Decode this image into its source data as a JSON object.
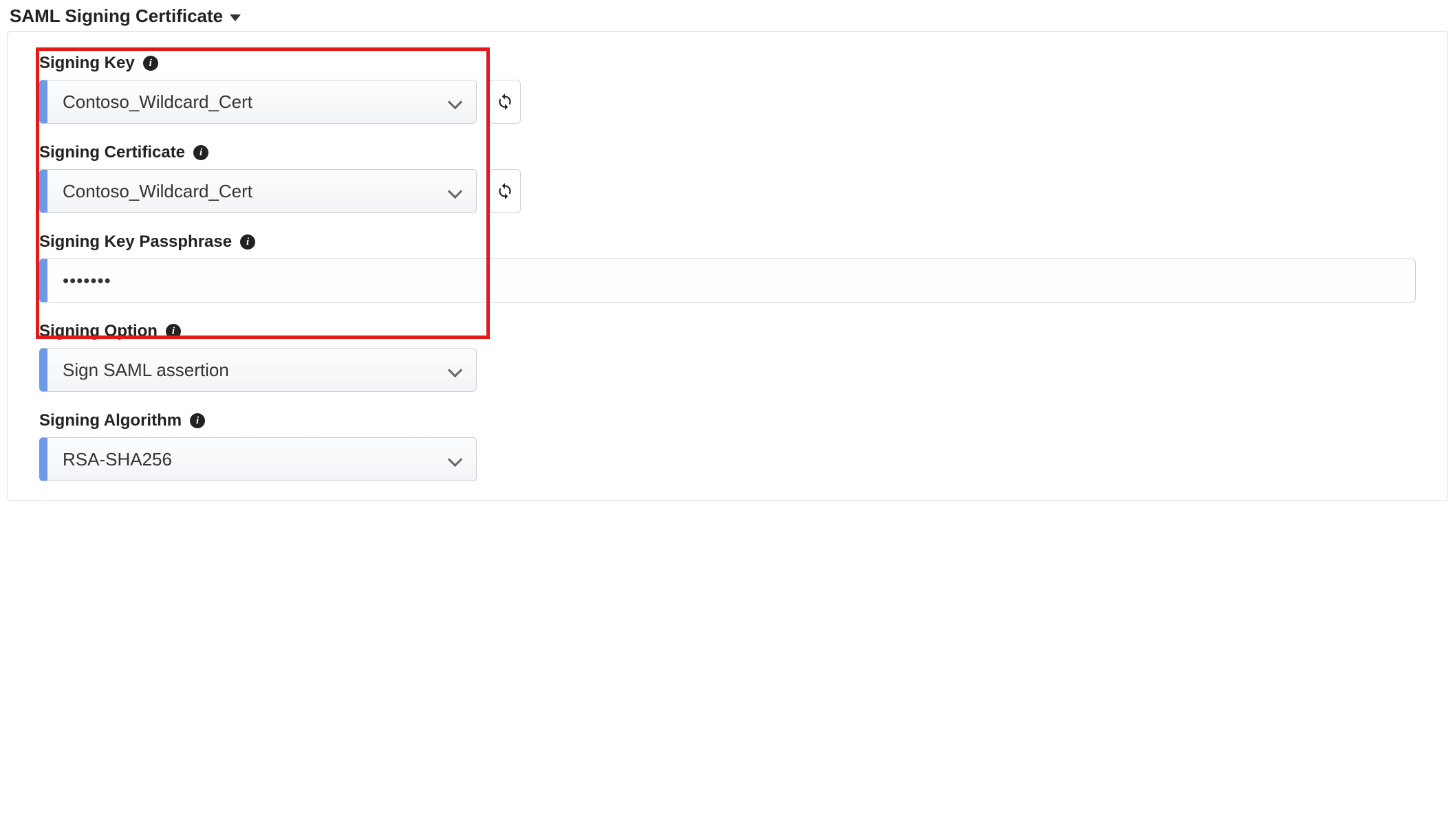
{
  "section_title": "SAML Signing Certificate",
  "fields": {
    "signing_key": {
      "label": "Signing Key",
      "value": "Contoso_Wildcard_Cert"
    },
    "signing_cert": {
      "label": "Signing Certificate",
      "value": "Contoso_Wildcard_Cert"
    },
    "signing_passphrase": {
      "label": "Signing Key Passphrase",
      "value": "•••••••"
    },
    "signing_option": {
      "label": "Signing Option",
      "value": "Sign SAML assertion"
    },
    "signing_algorithm": {
      "label": "Signing Algorithm",
      "value": "RSA-SHA256"
    }
  }
}
